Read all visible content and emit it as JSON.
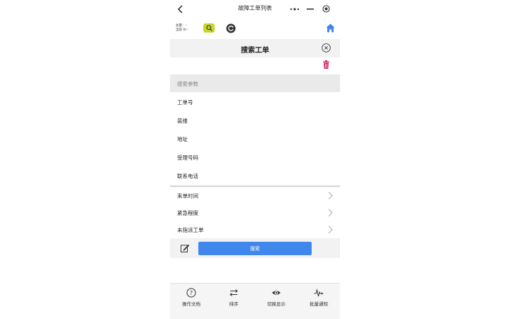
{
  "header": {
    "title": "故障工单列表",
    "more_icon": "more-dots-icon",
    "minimize_icon": "minimize-icon",
    "close_icon": "target-close-icon"
  },
  "toolbar": {
    "stat_line1": "总量：-",
    "stat_line2": "当前 0/--"
  },
  "panel": {
    "title": "搜索工单"
  },
  "search_section": {
    "label": "搜索参数",
    "fields": [
      "工单号",
      "装维",
      "地址",
      "受理号码",
      "联系电话"
    ],
    "options": [
      "来单时间",
      "紧急程度",
      "未指派工单"
    ]
  },
  "actions": {
    "search_label": "搜索",
    "accent": "#3f87ea"
  },
  "bottom_nav": [
    {
      "label": "操作文档",
      "icon": "help-icon"
    },
    {
      "label": "排序",
      "icon": "sort-arrows-icon"
    },
    {
      "label": "切换显示",
      "icon": "eye-icon"
    },
    {
      "label": "批量通知",
      "icon": "pulse-icon"
    }
  ],
  "colors": {
    "search_icon_bg": "#c6d62a",
    "trash": "#d9265f",
    "home": "#3f87ea"
  }
}
